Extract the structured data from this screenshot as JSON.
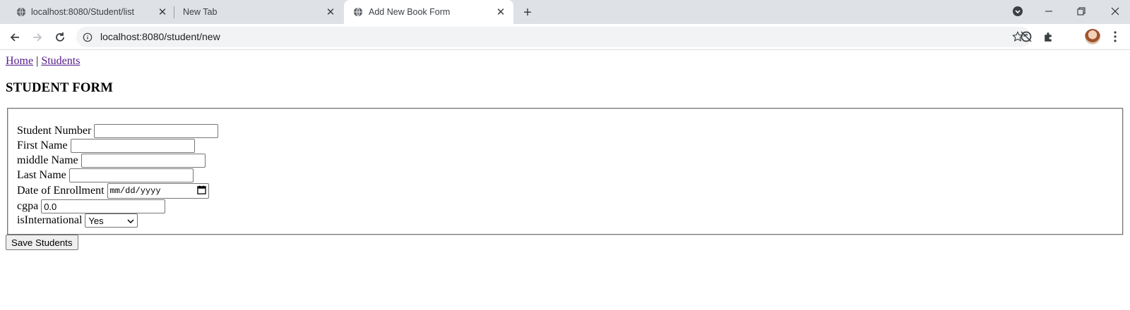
{
  "browser": {
    "tabs": [
      {
        "title": "localhost:8080/Student/list",
        "active": false
      },
      {
        "title": "New Tab",
        "active": false
      },
      {
        "title": "Add New Book Form",
        "active": true
      }
    ],
    "url": "localhost:8080/student/new"
  },
  "page": {
    "nav": {
      "home": "Home",
      "separator": "|",
      "students": "Students"
    },
    "heading": "STUDENT FORM",
    "form": {
      "student_number_label": "Student Number",
      "student_number_value": "",
      "first_name_label": "First Name",
      "first_name_value": "",
      "middle_name_label": "middle Name",
      "middle_name_value": "",
      "last_name_label": "Last Name",
      "last_name_value": "",
      "enrollment_label": "Date of Enrollment",
      "enrollment_placeholder": "mm/dd/yyyy",
      "cgpa_label": "cgpa",
      "cgpa_value": "0.0",
      "international_label": "isInternational",
      "international_selected": "Yes"
    },
    "save_button": "Save Students"
  }
}
